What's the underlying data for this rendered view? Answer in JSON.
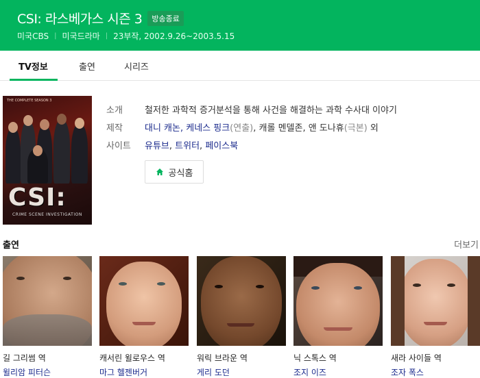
{
  "header": {
    "title": "CSI: 라스베가스 시즌 3",
    "badge": "방송종료",
    "meta": [
      "미국CBS",
      "미국드라마",
      "23부작, 2002.9.26~2003.5.15"
    ]
  },
  "tabs": [
    {
      "label": "TV정보",
      "active": true
    },
    {
      "label": "출연",
      "active": false
    },
    {
      "label": "시리즈",
      "active": false
    }
  ],
  "poster": {
    "logo_text": "CSI:",
    "subtitle": "CRIME SCENE INVESTIGATION",
    "season_text": "THE COMPLETE SEASON 3"
  },
  "info": {
    "intro_label": "소개",
    "intro_value": "철저한 과학적 증거분석을 통해 사건을 해결하는 과학 수사대 이야기",
    "prod_label": "제작",
    "prod_directors": "대니 캐논, 케네스 핑크",
    "prod_directors_note": "(연출)",
    "prod_writers": ", 캐롤 멘델존, 앤 도나휴",
    "prod_writers_note": "(극본)",
    "prod_etc": " 외",
    "site_label": "사이트",
    "sites": [
      "유튜브",
      "트위터",
      "페이스북"
    ],
    "home_button": "공식홈"
  },
  "cast": {
    "heading": "출연",
    "more": "더보기",
    "members": [
      {
        "role": "길 그리썸 역",
        "actor": "윌리암 피터슨"
      },
      {
        "role": "캐서린 윌로우스 역",
        "actor": "마그 헬젠버거"
      },
      {
        "role": "워릭 브라운 역",
        "actor": "게리 도던"
      },
      {
        "role": "닉 스톡스 역",
        "actor": "조지 이즈"
      },
      {
        "role": "새라 사이들 역",
        "actor": "조자 폭스"
      }
    ]
  },
  "colors": {
    "header_bg": "#03b45e",
    "link": "#1a2a8c"
  }
}
